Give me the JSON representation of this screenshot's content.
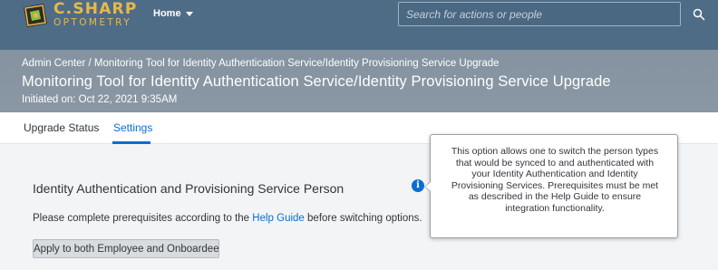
{
  "shell": {
    "logo": {
      "line1": "C.SHARP",
      "line2": "OPTOMETRY"
    },
    "home_label": "Home",
    "search": {
      "placeholder": "Search for actions or people",
      "value": ""
    }
  },
  "header": {
    "breadcrumb": {
      "root": "Admin Center",
      "separator": " / ",
      "current": "Monitoring Tool for Identity Authentication Service/Identity Provisioning Service Upgrade"
    },
    "title": "Monitoring Tool for Identity Authentication Service/Identity Provisioning Service Upgrade",
    "subtitle": "Initiated on: Oct 22, 2021 9:35AM"
  },
  "tabs": [
    {
      "label": "Upgrade Status",
      "active": false
    },
    {
      "label": "Settings",
      "active": true
    }
  ],
  "content": {
    "section_title": "Identity Authentication and Provisioning Service Person",
    "prereq": {
      "before": "Please complete prerequisites according to the ",
      "link": "Help Guide",
      "after": " before switching options."
    },
    "apply_button": "Apply to both Employee and Onboardee"
  },
  "popover": {
    "text": "This option allows one to switch the person types that would be synced to and authenticated with your Identity Authentication and Identity Provisioning Services. Prerequisites must be met as described in the Help Guide to ensure integration functionality."
  },
  "icons": {
    "logo": "logo-mark-icon",
    "caret": "chevron-down-icon",
    "search": "search-icon",
    "info": "info-icon"
  },
  "colors": {
    "shell_bg": "#4f6c86",
    "header_bg": "#8592a0",
    "accent": "#0a6ed1",
    "logo_gold": "#e8b84a",
    "page_bg": "#f3f4f5"
  }
}
